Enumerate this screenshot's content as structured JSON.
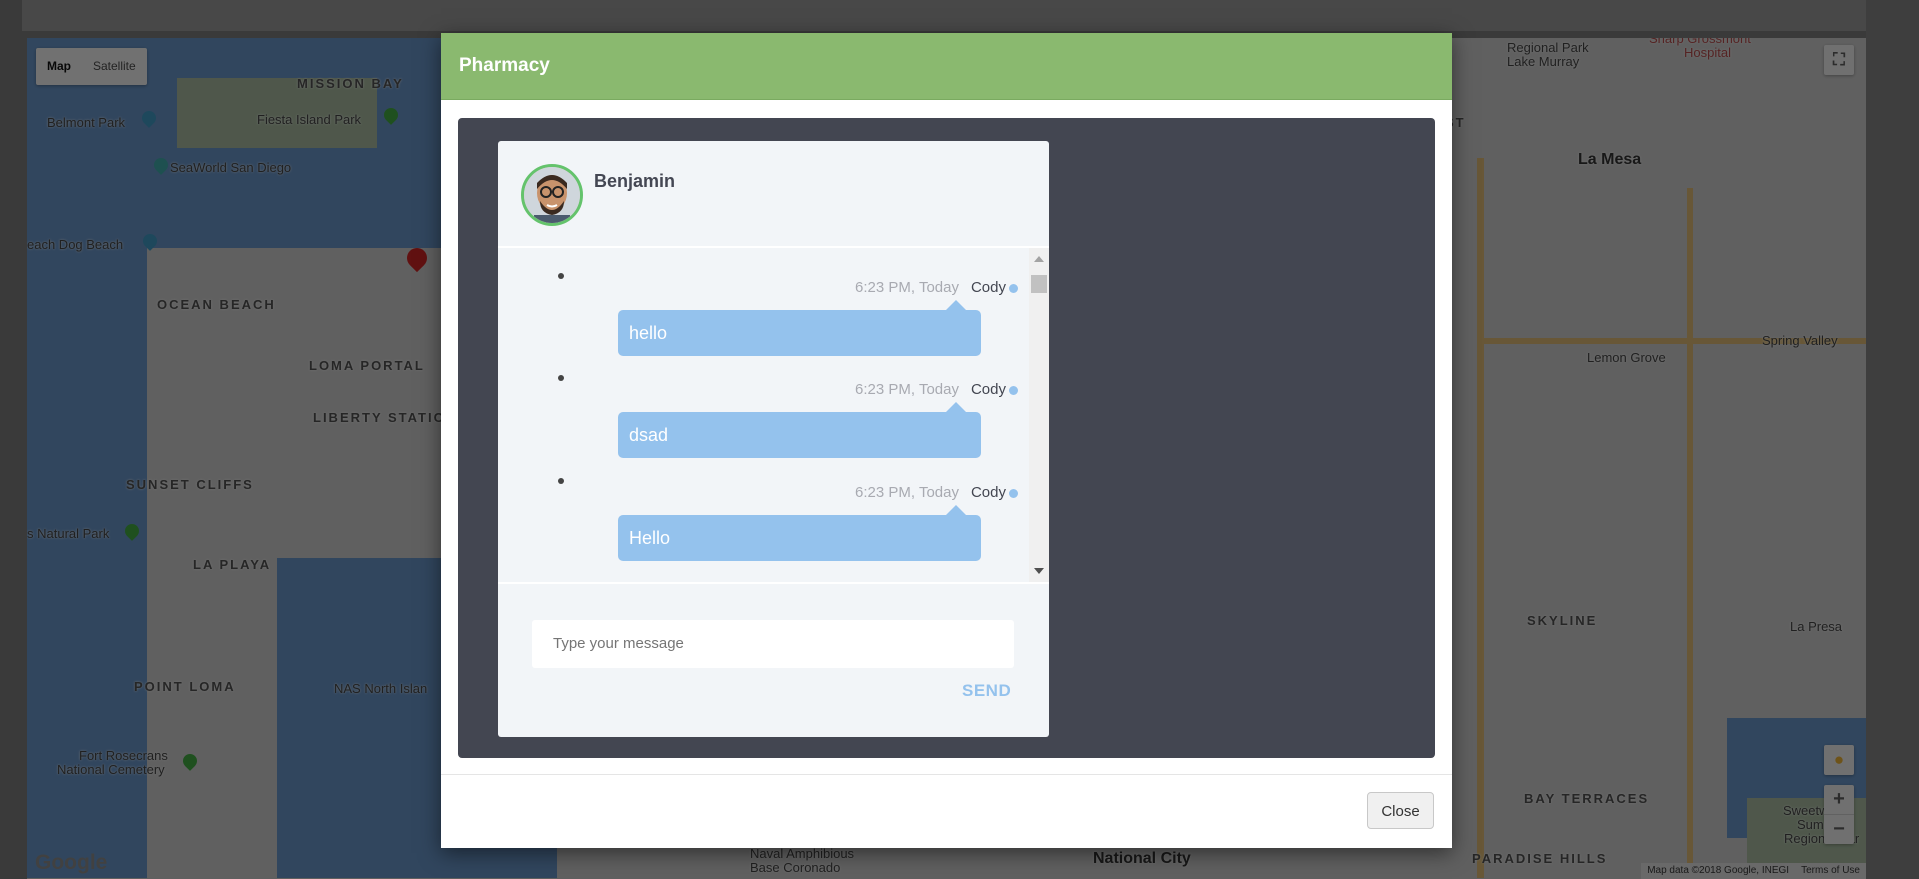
{
  "map": {
    "type_controls": [
      "Map",
      "Satellite"
    ],
    "labels": {
      "mission_bay": "MISSION BAY",
      "belmont_park": "Belmont Park",
      "fiesta_island": "Fiesta Island Park",
      "seaworld": "SeaWorld San Diego",
      "dog_beach": "each Dog Beach",
      "ocean_beach": "OCEAN BEACH",
      "loma_portal": "LOMA PORTAL",
      "liberty_station": "LIBERTY STATIO",
      "sunset_cliffs": "SUNSET CLIFFS",
      "natural_park": "s Natural Park",
      "la_playa": "LA PLAYA",
      "point_loma": "POINT LOMA",
      "nas_north": "NAS North Islan",
      "fort_rosecrans_1": "Fort Rosecrans",
      "fort_rosecrans_2": "National Cemetery",
      "naval_1": "Naval Amphibious",
      "naval_2": "Base Coronado",
      "national_city": "National City",
      "regional_park_1": "Regional Park",
      "regional_park_2": "Lake Murray",
      "sharp_1": "Sharp Grossmont",
      "sharp_2": "Hospital",
      "la_mesa": "La Mesa",
      "lemon_grove": "Lemon Grove",
      "spring_valley": "Spring Valley",
      "skyline": "SKYLINE",
      "la_presa": "La Presa",
      "bay_terraces": "BAY TERRACES",
      "paradise_hills": "PARADISE HILLS",
      "sweetwater_1": "Sweetwater",
      "sweetwater_2": "Summit",
      "sweetwater_3": "Regional Par",
      "st": "ST"
    },
    "google": "Google",
    "footer_data": "Map data ©2018 Google, INEGI",
    "footer_terms": "Terms of Use",
    "zoom_in": "+",
    "zoom_out": "−"
  },
  "modal": {
    "title": "Pharmacy",
    "close_label": "Close"
  },
  "chat": {
    "contact_name": "Benjamin",
    "messages": [
      {
        "time": "6:23 PM, Today",
        "sender": "Cody",
        "text": "hello"
      },
      {
        "time": "6:23 PM, Today",
        "sender": "Cody",
        "text": "dsad"
      },
      {
        "time": "6:23 PM, Today",
        "sender": "Cody",
        "text": "Hello"
      }
    ],
    "input_placeholder": "Type your message",
    "send_label": "SEND"
  },
  "colors": {
    "header_green": "#8ab96f",
    "chat_bg": "#434651",
    "bubble": "#94c2ed",
    "avatar_ring": "#64c36c"
  }
}
